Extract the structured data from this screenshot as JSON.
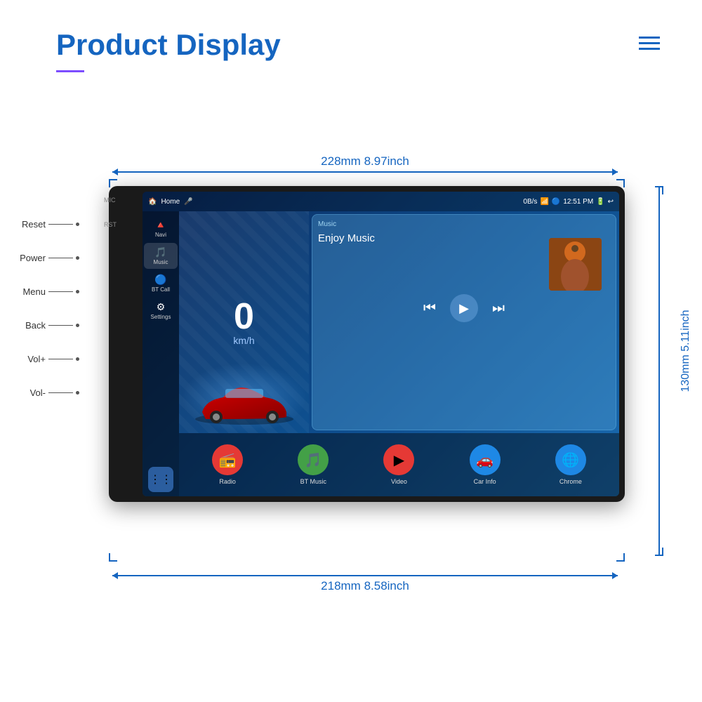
{
  "page": {
    "title": "Product Display",
    "menu_icon": "≡",
    "accent_color": "#1565c0",
    "purple_accent": "#7c4dff"
  },
  "dimensions": {
    "top_label": "228mm 8.97inch",
    "bottom_label": "218mm 8.58inch",
    "right_label": "130mm\n5.11inch"
  },
  "side_buttons": [
    {
      "label": "Reset"
    },
    {
      "label": "Power"
    },
    {
      "label": "Menu"
    },
    {
      "label": "Back"
    },
    {
      "label": "Vol+"
    },
    {
      "label": "Vol-"
    }
  ],
  "status_bar": {
    "left": "Home",
    "center": "0B/s",
    "time": "12:51 PM"
  },
  "nav_items": [
    {
      "icon": "🔺",
      "label": "Navi"
    },
    {
      "icon": "🎵",
      "label": "Music"
    },
    {
      "icon": "🔵",
      "label": "BT Call"
    },
    {
      "icon": "⚙",
      "label": "Settings"
    }
  ],
  "speed": {
    "value": "0",
    "unit": "km/h"
  },
  "music": {
    "header": "Music",
    "title": "Enjoy Music",
    "controls": {
      "prev": "⏮",
      "play": "▶",
      "next": "⏭"
    }
  },
  "apps": [
    {
      "label": "Radio",
      "icon": "📻",
      "color": "#e53935"
    },
    {
      "label": "BT Music",
      "icon": "🎵",
      "color": "#43a047"
    },
    {
      "label": "Video",
      "icon": "▶",
      "color": "#e53935"
    },
    {
      "label": "Car Info",
      "icon": "🚗",
      "color": "#1e88e5"
    },
    {
      "label": "Chrome",
      "icon": "🌐",
      "color": "#1e88e5"
    }
  ],
  "labels": {
    "mic": "MIC",
    "rst": "RST"
  }
}
